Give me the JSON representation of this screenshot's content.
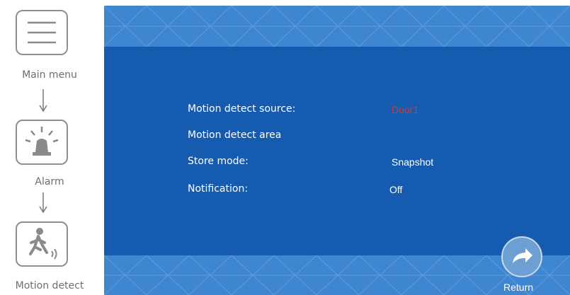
{
  "nav": {
    "steps": [
      {
        "label": "Main menu",
        "icon": "menu-icon"
      },
      {
        "label": "Alarm",
        "icon": "alarm-siren-icon"
      },
      {
        "label": "Motion detect",
        "icon": "motion-person-icon"
      }
    ]
  },
  "settings": {
    "rows": [
      {
        "label": "Motion detect source:",
        "value": "Door1",
        "value_color": "#d23a3a"
      },
      {
        "label": "Motion detect area",
        "value": ""
      },
      {
        "label": "Store mode:",
        "value": "Snapshot"
      },
      {
        "label": "Notification:",
        "value": "Off"
      }
    ]
  },
  "footer": {
    "return_label": "Return"
  },
  "colors": {
    "screen_bg": "#155cb0",
    "band": "#3f86d0",
    "highlight": "#d23a3a"
  }
}
